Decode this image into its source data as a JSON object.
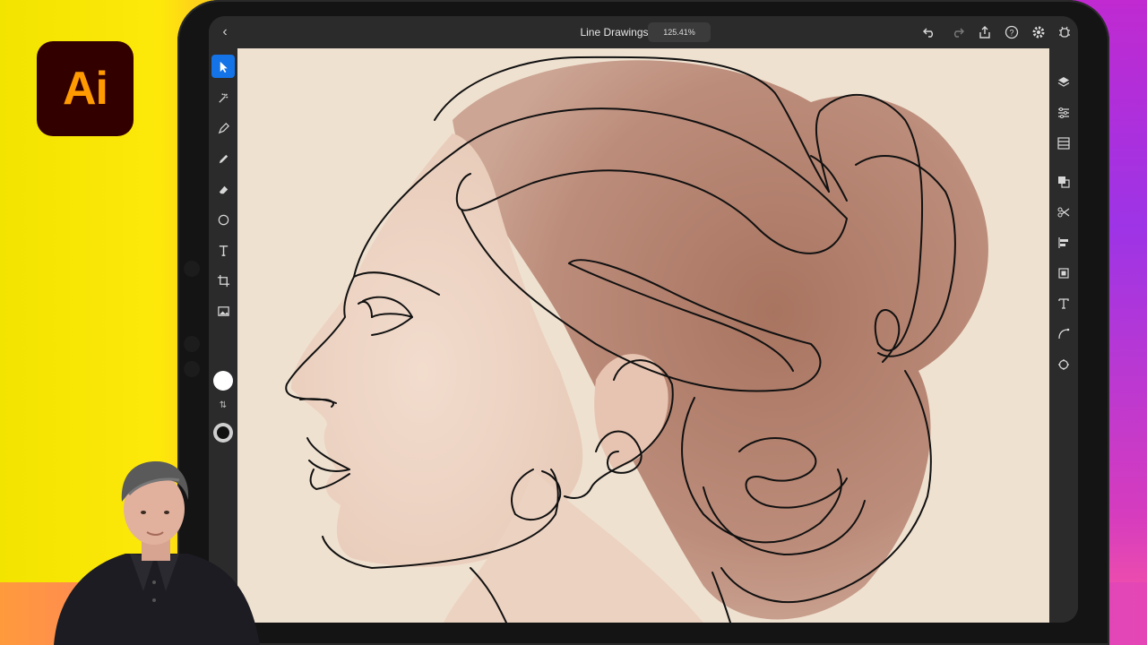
{
  "app": {
    "logo_text": "Ai",
    "brand_color": "#ff9a00",
    "logo_bg": "#330000"
  },
  "topbar": {
    "document_title": "Line Drawings",
    "zoom_level": "125.41%",
    "icons": [
      "back-icon",
      "undo-icon",
      "redo-icon",
      "share-icon",
      "help-icon",
      "settings-icon",
      "bug-icon"
    ]
  },
  "left_toolbar": {
    "tools": [
      "selection-tool",
      "direct-select-tool",
      "pen-tool",
      "pencil-tool",
      "eraser-tool",
      "shape-tool",
      "type-tool",
      "crop-tool",
      "image-tool"
    ],
    "active_tool": "selection-tool",
    "fill_color": "#ffffff",
    "stroke_color": "#111111"
  },
  "right_toolbar": {
    "tools": [
      "layers-icon",
      "properties-icon",
      "libraries-icon",
      "pathfinder-icon",
      "scissors-icon",
      "align-icon",
      "transform-icon",
      "text-settings-icon",
      "curvature-icon",
      "plugins-icon"
    ]
  },
  "colors": {
    "accent": "#1473e6",
    "canvas_bg": "#efe1d0",
    "ui_dark": "#2b2b2b"
  }
}
